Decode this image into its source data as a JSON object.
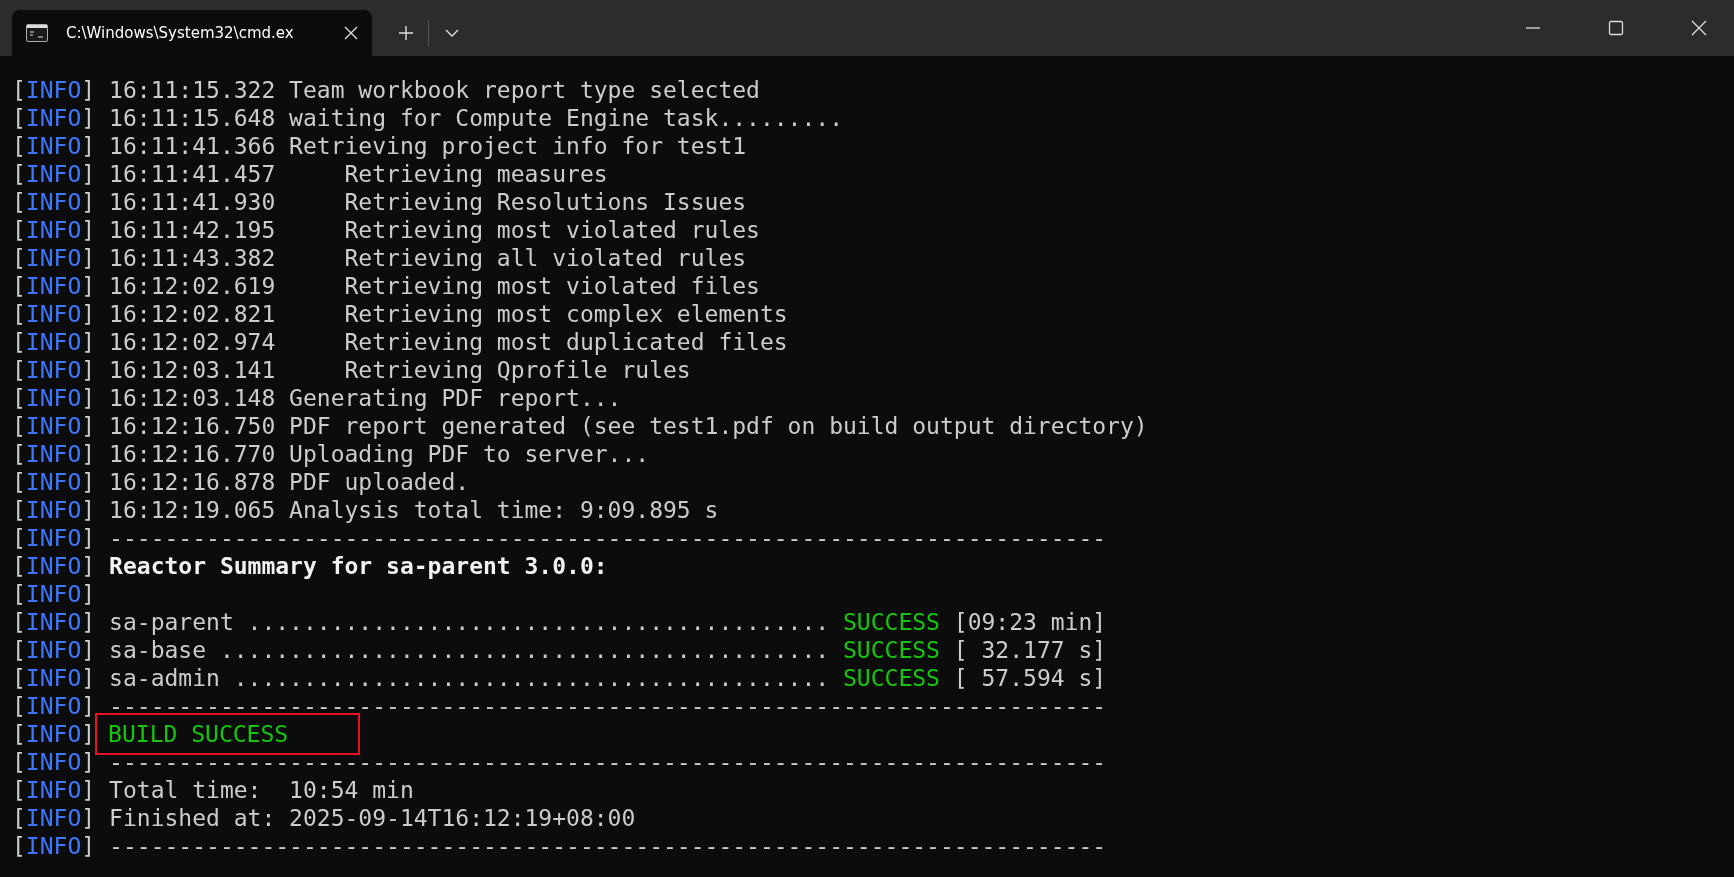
{
  "tab": {
    "title": "C:\\Windows\\System32\\cmd.ex",
    "selected": true
  },
  "lines": [
    {
      "level": "[INFO]",
      "kind": "plain",
      "text": "16:11:15.322 Team workbook report type selected"
    },
    {
      "level": "[INFO]",
      "kind": "plain",
      "text": "16:11:15.648 waiting for Compute Engine task........."
    },
    {
      "level": "[INFO]",
      "kind": "plain",
      "text": "16:11:41.366 Retrieving project info for test1"
    },
    {
      "level": "[INFO]",
      "kind": "plain",
      "text": "16:11:41.457     Retrieving measures"
    },
    {
      "level": "[INFO]",
      "kind": "plain",
      "text": "16:11:41.930     Retrieving Resolutions Issues"
    },
    {
      "level": "[INFO]",
      "kind": "plain",
      "text": "16:11:42.195     Retrieving most violated rules"
    },
    {
      "level": "[INFO]",
      "kind": "plain",
      "text": "16:11:43.382     Retrieving all violated rules"
    },
    {
      "level": "[INFO]",
      "kind": "plain",
      "text": "16:12:02.619     Retrieving most violated files"
    },
    {
      "level": "[INFO]",
      "kind": "plain",
      "text": "16:12:02.821     Retrieving most complex elements"
    },
    {
      "level": "[INFO]",
      "kind": "plain",
      "text": "16:12:02.974     Retrieving most duplicated files"
    },
    {
      "level": "[INFO]",
      "kind": "plain",
      "text": "16:12:03.141     Retrieving Qprofile rules"
    },
    {
      "level": "[INFO]",
      "kind": "plain",
      "text": "16:12:03.148 Generating PDF report..."
    },
    {
      "level": "[INFO]",
      "kind": "plain",
      "text": "16:12:16.750 PDF report generated (see test1.pdf on build output directory)"
    },
    {
      "level": "[INFO]",
      "kind": "plain",
      "text": "16:12:16.770 Uploading PDF to server..."
    },
    {
      "level": "[INFO]",
      "kind": "plain",
      "text": "16:12:16.878 PDF uploaded."
    },
    {
      "level": "[INFO]",
      "kind": "plain",
      "text": "16:12:19.065 Analysis total time: 9:09.895 s"
    },
    {
      "level": "[INFO]",
      "kind": "plain",
      "text": "------------------------------------------------------------------------"
    },
    {
      "level": "[INFO]",
      "kind": "heading",
      "text": "Reactor Summary for sa-parent 3.0.0:"
    },
    {
      "level": "[INFO]",
      "kind": "empty"
    },
    {
      "level": "[INFO]",
      "kind": "module",
      "text": "sa-parent .......................................... ",
      "status": "SUCCESS",
      "time": " [09:23 min]"
    },
    {
      "level": "[INFO]",
      "kind": "module",
      "text": "sa-base ............................................ ",
      "status": "SUCCESS",
      "time": " [ 32.177 s]"
    },
    {
      "level": "[INFO]",
      "kind": "module",
      "text": "sa-admin ........................................... ",
      "status": "SUCCESS",
      "time": " [ 57.594 s]"
    },
    {
      "level": "[INFO]",
      "kind": "plain",
      "text": "------------------------------------------------------------------------"
    },
    {
      "level": "[INFO]",
      "kind": "result",
      "text": "BUILD SUCCESS",
      "boxed": true
    },
    {
      "level": "[INFO]",
      "kind": "plain",
      "text": "------------------------------------------------------------------------"
    },
    {
      "level": "[INFO]",
      "kind": "plain",
      "text": "Total time:  10:54 min"
    },
    {
      "level": "[INFO]",
      "kind": "plain",
      "text": "Finished at: 2025-09-14T16:12:19+08:00"
    },
    {
      "level": "[INFO]",
      "kind": "plain",
      "text": "------------------------------------------------------------------------"
    }
  ]
}
